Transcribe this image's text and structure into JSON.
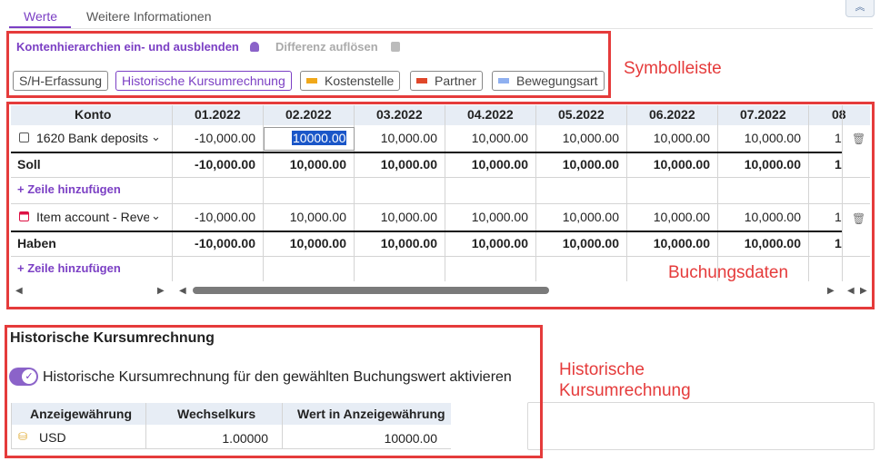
{
  "tabs": [
    {
      "label": "Werte",
      "active": true
    },
    {
      "label": "Weitere Informationen",
      "active": false
    }
  ],
  "toolbar": {
    "toggle_hierarchy": "Kontenhierarchien ein- und ausblenden",
    "resolve_difference": "Differenz auflösen",
    "chips": [
      {
        "label": "S/H-Erfassung",
        "active": false,
        "swatch": null
      },
      {
        "label": "Historische Kursumrechnung",
        "active": true,
        "swatch": null
      },
      {
        "label": "Kostenstelle",
        "active": false,
        "swatch": "#f0a81a"
      },
      {
        "label": "Partner",
        "active": false,
        "swatch": "#e0472a"
      },
      {
        "label": "Bewegungsart",
        "active": false,
        "swatch": "#8fb0f0"
      }
    ]
  },
  "annotations": {
    "toolbar": "Symbolleiste",
    "booking": "Buchungsdaten",
    "historical_line1": "Historische",
    "historical_line2": "Kursumrechnung"
  },
  "grid": {
    "account_header": "Konto",
    "periods": [
      "01.2022",
      "02.2022",
      "03.2022",
      "04.2022",
      "05.2022",
      "06.2022",
      "07.2022",
      "08"
    ],
    "rows": [
      {
        "account": "1620 Bank deposits",
        "values": [
          "-10,000.00",
          "10000.00",
          "10,000.00",
          "10,000.00",
          "10,000.00",
          "10,000.00",
          "10,000.00",
          "1"
        ]
      },
      {
        "label": "Soll",
        "values": [
          "-10,000.00",
          "10,000.00",
          "10,000.00",
          "10,000.00",
          "10,000.00",
          "10,000.00",
          "10,000.00",
          "1"
        ]
      },
      {
        "add": "Zeile hinzufügen"
      },
      {
        "account": "Item account - Rever",
        "values": [
          "-10,000.00",
          "10,000.00",
          "10,000.00",
          "10,000.00",
          "10,000.00",
          "10,000.00",
          "10,000.00",
          "1"
        ]
      },
      {
        "label": "Haben",
        "values": [
          "-10,000.00",
          "10,000.00",
          "10,000.00",
          "10,000.00",
          "10,000.00",
          "10,000.00",
          "10,000.00",
          "1"
        ]
      },
      {
        "add": "Zeile hinzufügen"
      }
    ]
  },
  "historical": {
    "title": "Historische Kursumrechnung",
    "toggle_label": "Historische Kursumrechnung für den gewählten Buchungswert aktivieren",
    "toggle_on": true,
    "columns": [
      "Anzeigewährung",
      "Wechselkurs",
      "Wert in Anzeigewährung"
    ],
    "row": {
      "currency": "USD",
      "rate": "1.00000",
      "value": "10000.00"
    }
  },
  "colors": {
    "accent": "#7b3fc4",
    "annotation_red": "#e53b3b",
    "header_bg": "#e7edf5"
  }
}
